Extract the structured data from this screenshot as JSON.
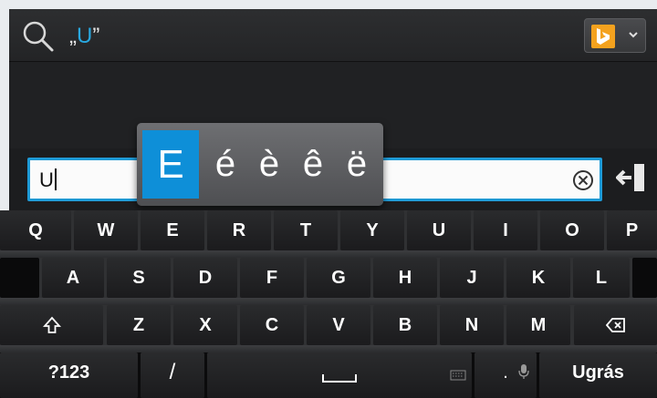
{
  "search": {
    "query_open": "„",
    "query_char": "U",
    "query_close": "”"
  },
  "input": {
    "value": "U"
  },
  "accent_popup": {
    "chars": [
      "E",
      "é",
      "è",
      "ê",
      "ë"
    ]
  },
  "keyboard": {
    "row1": [
      "Q",
      "W",
      "E",
      "R",
      "T",
      "Y",
      "U",
      "I",
      "O",
      "P"
    ],
    "row2": [
      "A",
      "S",
      "D",
      "F",
      "G",
      "H",
      "J",
      "K",
      "L"
    ],
    "row3": [
      "Z",
      "X",
      "C",
      "V",
      "B",
      "N",
      "M"
    ],
    "symbols_label": "?123",
    "slash_label": "/",
    "period_label": ".",
    "go_label": "Ugrás"
  },
  "colors": {
    "accent_blue": "#0e8fd8",
    "bing_orange": "#f4a21e"
  },
  "icons": [
    "search-icon",
    "bing-logo-icon",
    "chevron-down-icon",
    "clear-icon",
    "enter-icon",
    "shift-icon",
    "backspace-icon",
    "space-icon",
    "microphone-icon",
    "keyboard-icon"
  ]
}
